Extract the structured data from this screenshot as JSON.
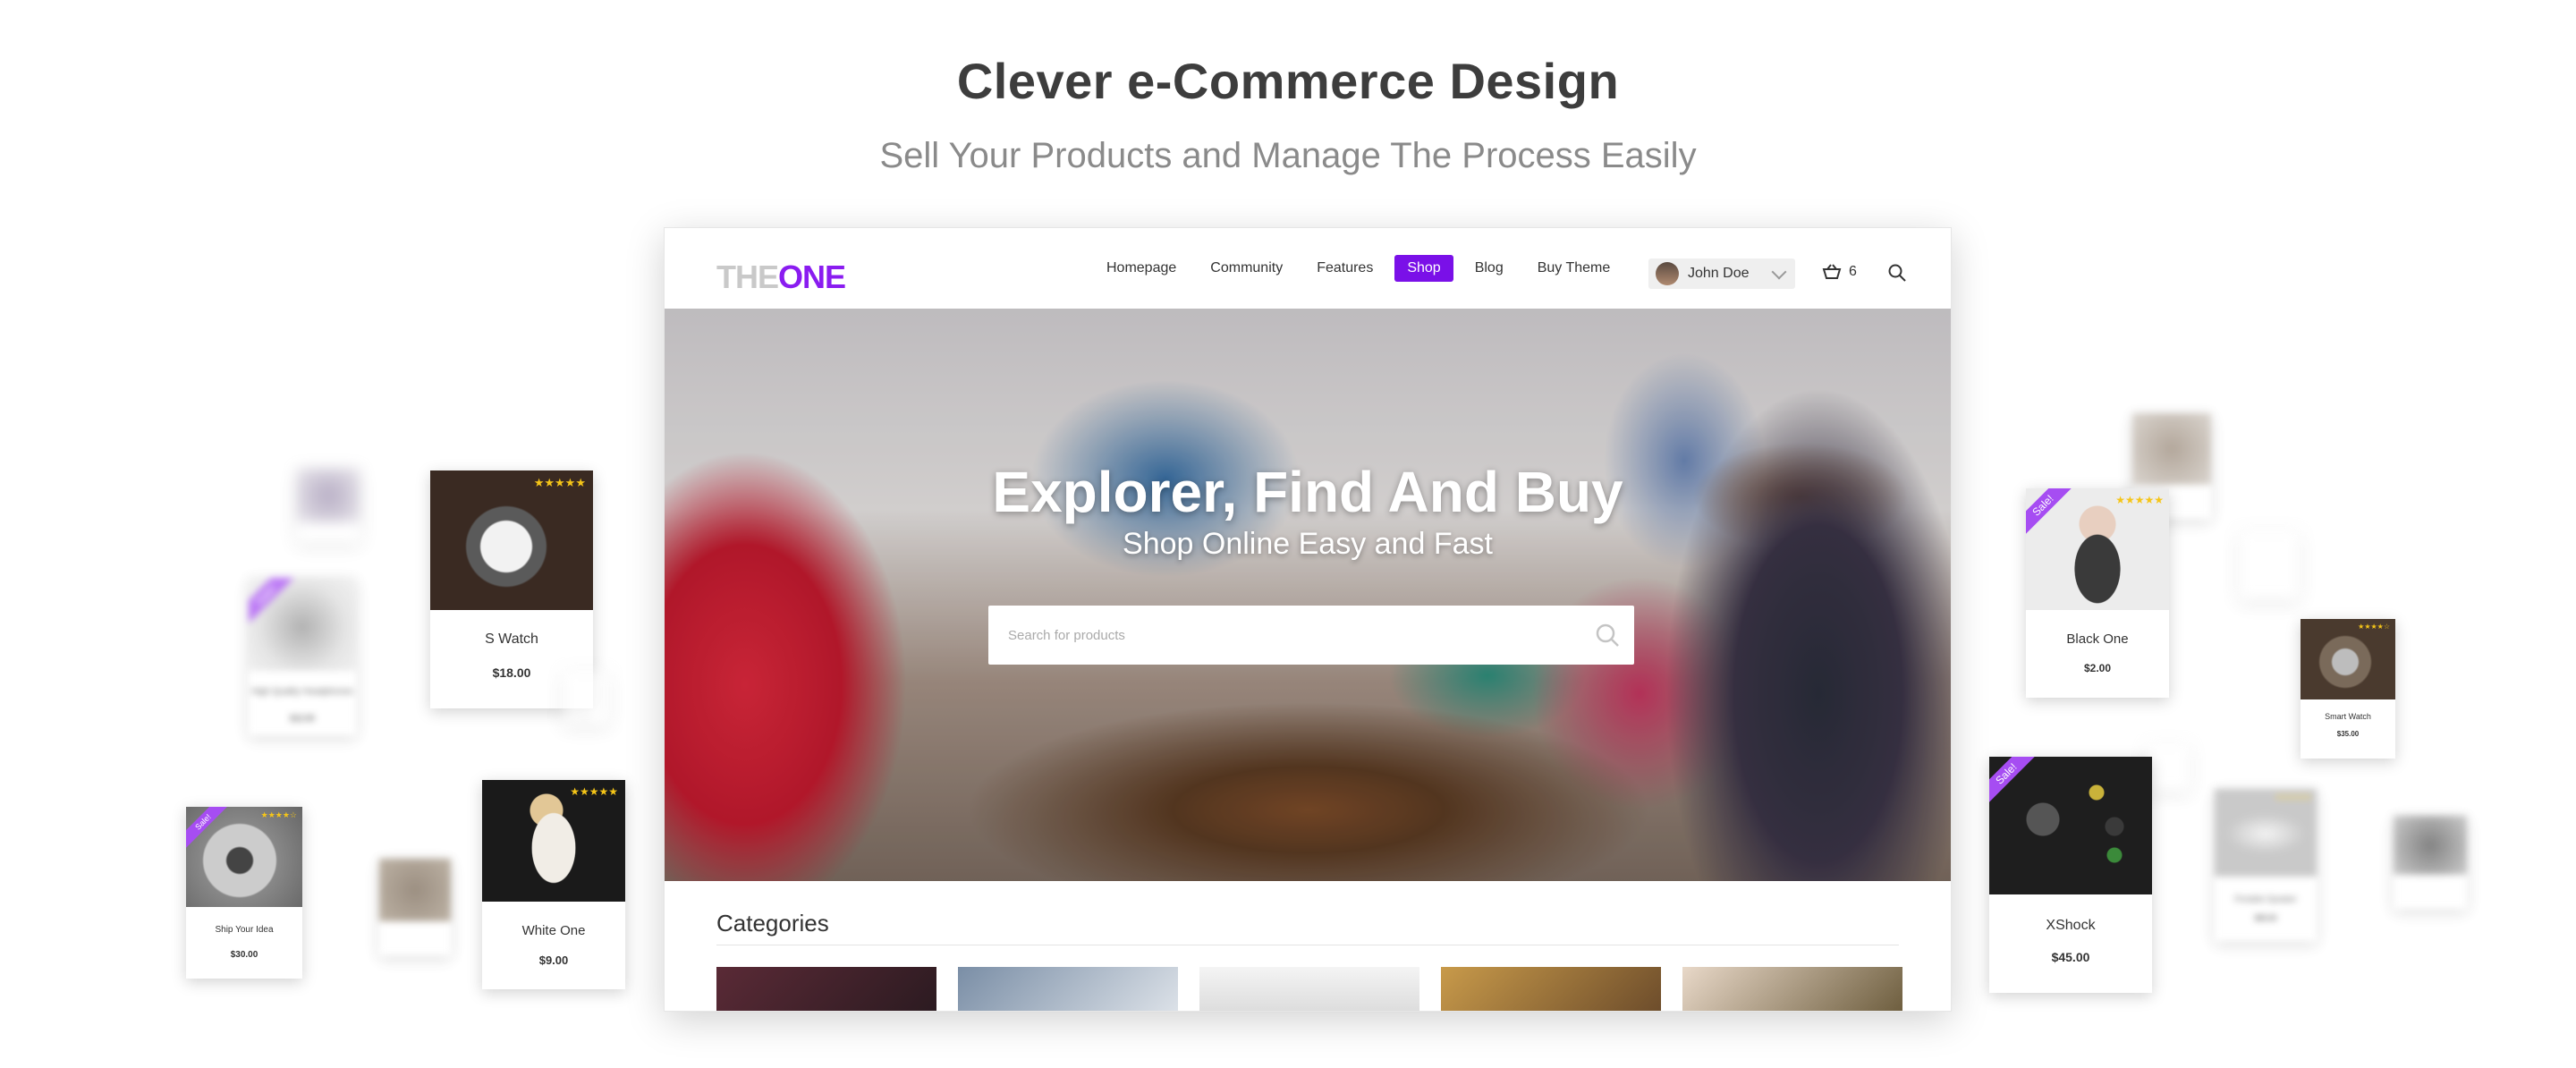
{
  "headline": "Clever e-Commerce Design",
  "subline": "Sell Your Products and Manage The Process Easily",
  "site": {
    "logo_a": "THE",
    "logo_b": "ONE",
    "nav": [
      "Homepage",
      "Community",
      "Features",
      "Shop",
      "Blog",
      "Buy Theme"
    ],
    "active_nav": "Shop",
    "user_name": "John Doe",
    "cart_count": "6"
  },
  "hero": {
    "title": "Explorer, Find And Buy",
    "subtitle": "Shop Online Easy and Fast",
    "search_placeholder": "Search for products"
  },
  "categories": {
    "title": "Categories"
  },
  "cards": {
    "s_watch": {
      "name": "S Watch",
      "price": "$18.00",
      "stars": "★★★★★"
    },
    "white_one": {
      "name": "White One",
      "price": "$9.00",
      "stars": "★★★★★"
    },
    "ship_your_idea": {
      "name": "Ship Your Idea",
      "price": "$30.00",
      "stars": "★★★★☆",
      "badge": "Sale!"
    },
    "high_quality_headphones": {
      "name": "High Quality Headphones",
      "price": "$12.00",
      "badge": "Sale!"
    },
    "black_one": {
      "name": "Black One",
      "price": "$2.00",
      "stars": "★★★★★",
      "badge": "Sale!"
    },
    "smart_watch": {
      "name": "Smart Watch",
      "price": "$35.00",
      "stars": "★★★★☆"
    },
    "xshock": {
      "name": "XShock",
      "price": "$45.00",
      "badge": "Sale!"
    },
    "portable_speaker": {
      "name": "Portable Speaker",
      "price": "$65.00",
      "stars": "★★★★★"
    }
  }
}
